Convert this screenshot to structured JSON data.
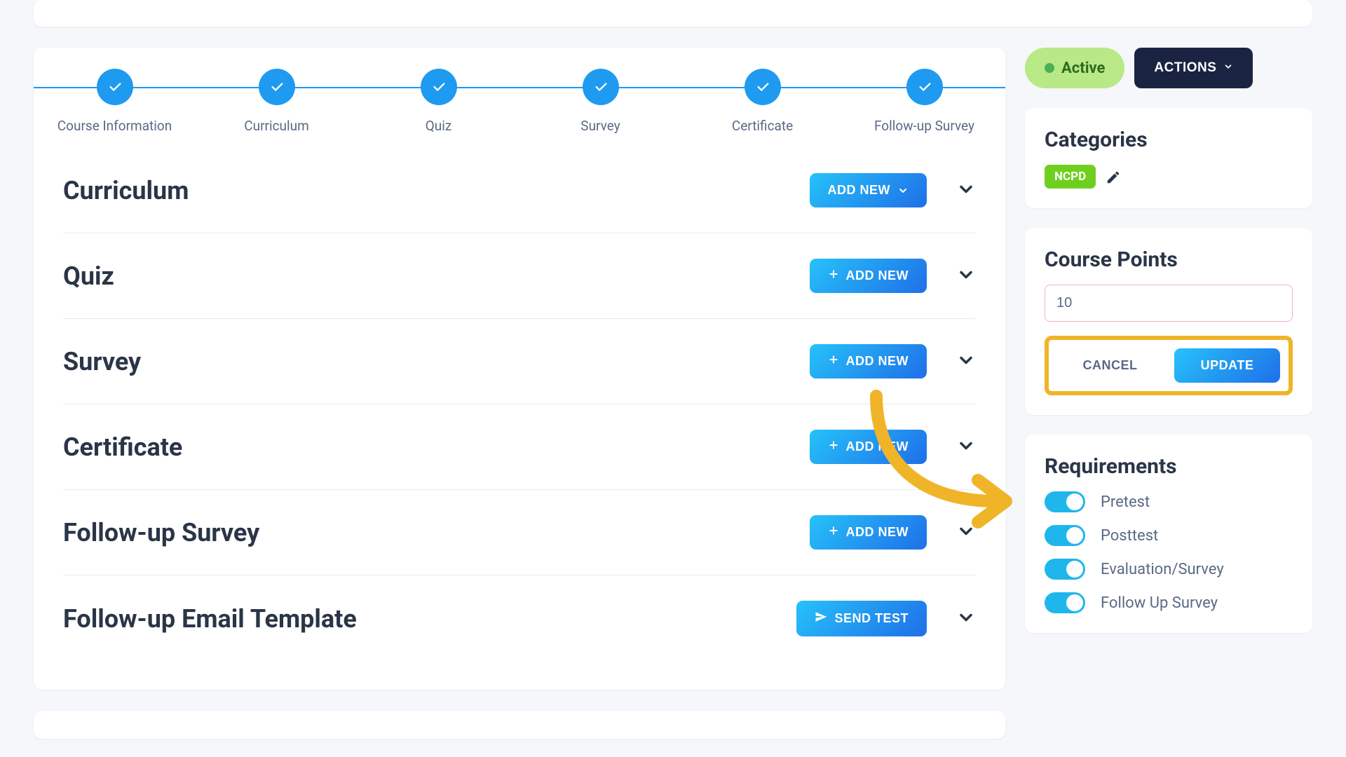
{
  "stepper": {
    "steps": [
      {
        "label": "Course Information"
      },
      {
        "label": "Curriculum"
      },
      {
        "label": "Quiz"
      },
      {
        "label": "Survey"
      },
      {
        "label": "Certificate"
      },
      {
        "label": "Follow-up Survey"
      }
    ]
  },
  "sections": {
    "curriculum": {
      "title": "Curriculum",
      "button": "ADD NEW"
    },
    "quiz": {
      "title": "Quiz",
      "button": "ADD NEW"
    },
    "survey": {
      "title": "Survey",
      "button": "ADD NEW"
    },
    "certificate": {
      "title": "Certificate",
      "button": "ADD NEW"
    },
    "followup_survey": {
      "title": "Follow-up Survey",
      "button": "ADD NEW"
    },
    "email_template": {
      "title": "Follow-up Email Template",
      "button": "SEND TEST"
    }
  },
  "side": {
    "status": {
      "label": "Active"
    },
    "actions_label": "ACTIONS",
    "categories": {
      "heading": "Categories",
      "tags": [
        "NCPD"
      ]
    },
    "course_points": {
      "heading": "Course Points",
      "value": "10",
      "cancel_label": "CANCEL",
      "update_label": "UPDATE"
    },
    "requirements": {
      "heading": "Requirements",
      "items": [
        {
          "label": "Pretest"
        },
        {
          "label": "Posttest"
        },
        {
          "label": "Evaluation/Survey"
        },
        {
          "label": "Follow Up Survey"
        }
      ]
    }
  }
}
